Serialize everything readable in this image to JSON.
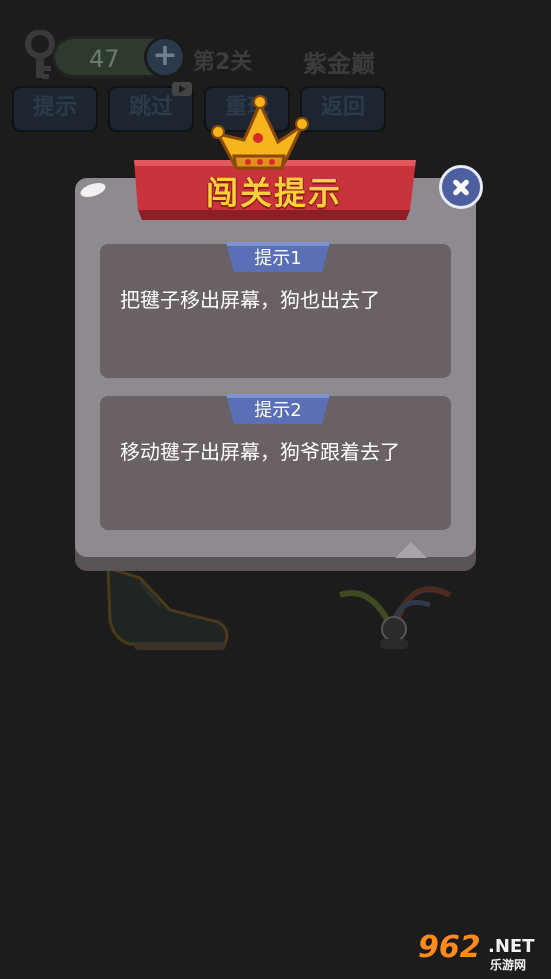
{
  "hud": {
    "key_count": "47",
    "level": "第2关",
    "rank": "紫金巅",
    "buttons": {
      "hint": "提示",
      "skip": "跳过",
      "retry": "重玩",
      "back": "返回"
    }
  },
  "modal": {
    "title": "闯关提示",
    "hints": [
      {
        "tag": "提示1",
        "text": "把毽子移出屏幕，狗也出去了"
      },
      {
        "tag": "提示2",
        "text": "移动毽子出屏幕，狗爷跟着去了"
      }
    ]
  },
  "watermark": {
    "logo": "962",
    "net": ".NET",
    "sub": "乐游网"
  },
  "colors": {
    "overlay": "#1c1c1c",
    "panel": "#8e8a8f",
    "card": "#6a6166",
    "ribbon": "#c9343c",
    "title": "#ffcf3c",
    "tag": "#5a6fb5",
    "close": "#4d5f9f"
  }
}
